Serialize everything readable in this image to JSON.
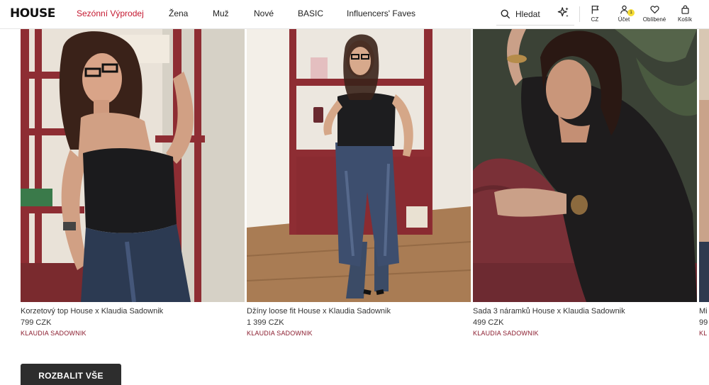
{
  "header": {
    "logo": "HOUSE",
    "nav": [
      "Sezónní Výprodej",
      "Žena",
      "Muž",
      "Nové",
      "BASIC",
      "Influencers' Faves"
    ],
    "search_label": "Hledat",
    "country": "CZ",
    "account": "Účet",
    "account_badge": "1",
    "favorites": "Oblíbené",
    "cart": "Košík",
    "accent_color": "#c4172f"
  },
  "products": [
    {
      "name": "Korzetový top House x Klaudia Sadownik",
      "price": "799 CZK",
      "brand": "KLAUDIA SADOWNIK"
    },
    {
      "name": "Džíny loose fit House x Klaudia Sadownik",
      "price": "1 399 CZK",
      "brand": "KLAUDIA SADOWNIK"
    },
    {
      "name": "Sada 3 náramků House x Klaudia Sadownik",
      "price": "499 CZK",
      "brand": "KLAUDIA SADOWNIK"
    },
    {
      "name": "Mi",
      "price": "99",
      "brand": "KL"
    }
  ],
  "expand_button": "ROZBALIT VŠE"
}
